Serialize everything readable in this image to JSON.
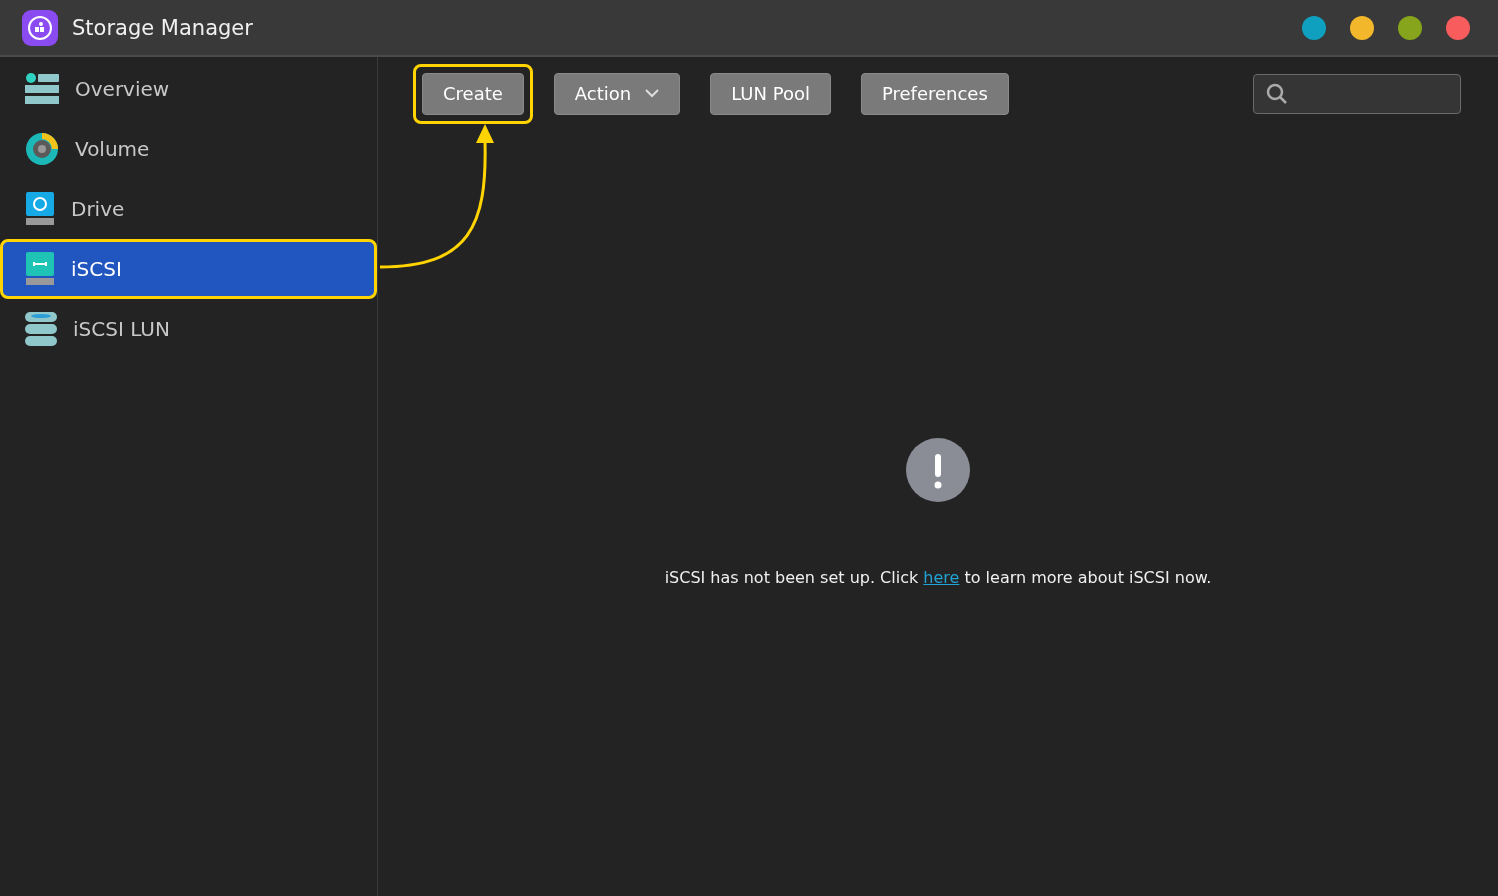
{
  "window": {
    "title": "Storage Manager"
  },
  "window_buttons": [
    {
      "color": "#0fa0c0"
    },
    {
      "color": "#f3b72b"
    },
    {
      "color": "#86a41c"
    },
    {
      "color": "#f85c5c"
    }
  ],
  "sidebar": {
    "items": [
      {
        "label": "Overview",
        "kind": "overview",
        "selected": false,
        "highlighted": false
      },
      {
        "label": "Volume",
        "kind": "volume",
        "selected": false,
        "highlighted": false
      },
      {
        "label": "Drive",
        "kind": "drive",
        "selected": false,
        "highlighted": false
      },
      {
        "label": "iSCSI",
        "kind": "iscsi",
        "selected": true,
        "highlighted": true
      },
      {
        "label": "iSCSI LUN",
        "kind": "lun",
        "selected": false,
        "highlighted": false
      }
    ]
  },
  "toolbar": {
    "buttons": [
      {
        "label": "Create",
        "kind": "plain",
        "highlighted": true
      },
      {
        "label": "Action",
        "kind": "dropdown",
        "highlighted": false
      },
      {
        "label": "LUN Pool",
        "kind": "plain",
        "highlighted": false
      },
      {
        "label": "Preferences",
        "kind": "plain",
        "highlighted": false
      }
    ]
  },
  "empty_state": {
    "text_before": "iSCSI has not been set up. Click ",
    "link": "here",
    "text_after": " to learn more about iSCSI now."
  }
}
